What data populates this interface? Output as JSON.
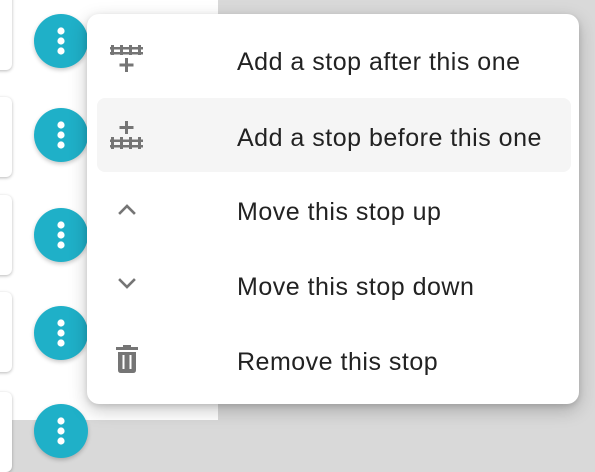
{
  "menu": {
    "items": [
      {
        "label": "Add a stop after this one",
        "icon": "add-stop-after-icon"
      },
      {
        "label": "Add a stop before this one",
        "icon": "add-stop-before-icon"
      },
      {
        "label": "Move this stop up",
        "icon": "chevron-up-icon"
      },
      {
        "label": "Move this stop down",
        "icon": "chevron-down-icon"
      },
      {
        "label": "Remove this stop",
        "icon": "trash-icon"
      }
    ]
  },
  "colors": {
    "fab": "#1fb0c8",
    "icon": "#757575",
    "backdrop": "#d9d9d9",
    "hover": "#f5f5f5"
  }
}
